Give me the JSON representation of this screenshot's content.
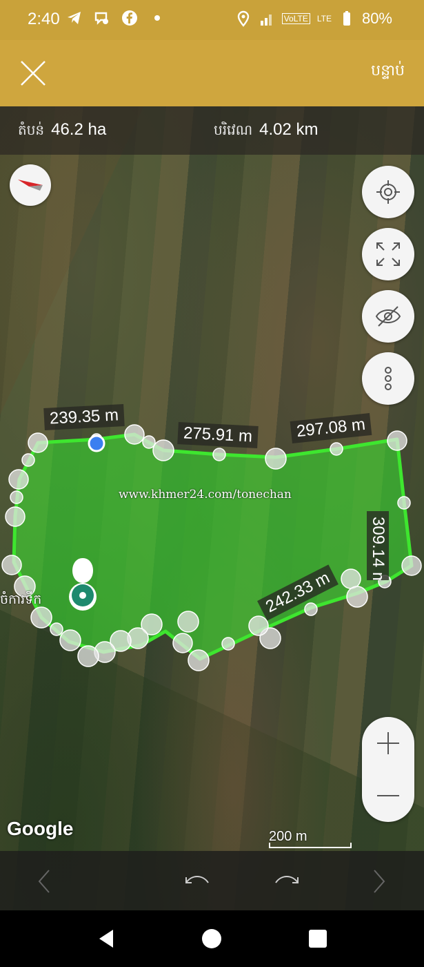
{
  "status_bar": {
    "time": "2:40",
    "left_icons": [
      "telegram-icon",
      "messenger-icon",
      "facebook-icon",
      "dot-icon"
    ],
    "right_icons": [
      "location-icon",
      "signal-icon",
      "volte-icon",
      "lte-signal-icon",
      "battery-icon"
    ],
    "volte_label": "VoLTE",
    "lte_label": "LTE",
    "battery": "80%"
  },
  "header": {
    "close_icon": "close-icon",
    "next_label": "បន្ទាប់",
    "background": "#cfa63e"
  },
  "stats": {
    "area_label": "តំបន់",
    "area_value": "46.2 ha",
    "perimeter_label": "បរិវេណ",
    "perimeter_value": "4.02 km"
  },
  "map": {
    "edge_labels": [
      "239.35 m",
      "275.91 m",
      "297.08 m",
      "309.14 m",
      "242.33 m"
    ],
    "watermark": "www.khmer24.com/tonechan",
    "poi_label": "ចំការ​ទឹក",
    "attribution": "Google",
    "scale_label": "200 m",
    "polygon_color": "#38d630"
  },
  "controls": {
    "compass": "compass-icon",
    "my_location": "crosshair-icon",
    "fullscreen": "expand-icon",
    "visibility": "eye-off-icon",
    "more": "more-vertical-icon",
    "zoom_in": "plus-icon",
    "zoom_out": "minus-icon"
  },
  "toolbar": [
    "chevron-left-icon",
    "undo-icon",
    "redo-icon",
    "chevron-right-icon"
  ],
  "nav_bar": [
    "back-icon",
    "home-icon",
    "recents-icon"
  ]
}
